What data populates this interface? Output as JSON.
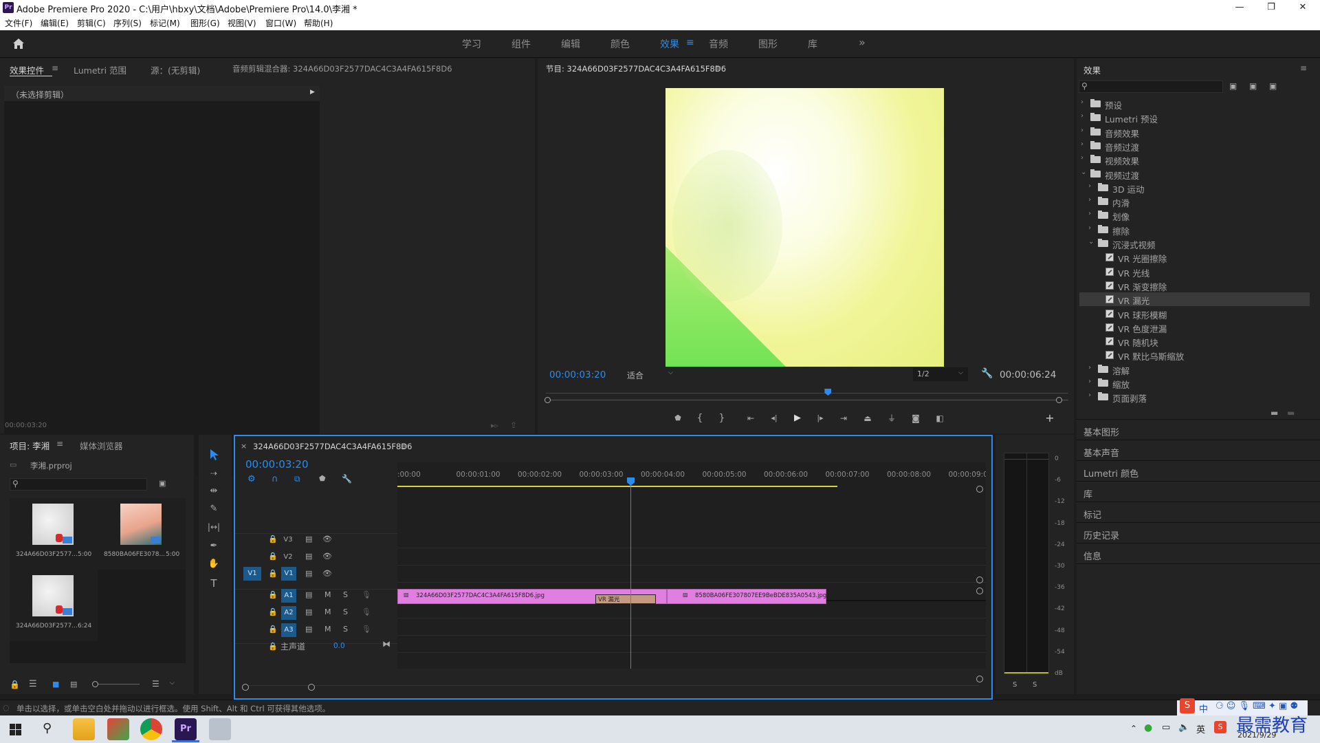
{
  "titlebar": {
    "title": "Adobe Premiere Pro 2020 - C:\\用户\\hbxy\\文档\\Adobe\\Premiere Pro\\14.0\\李湘 *",
    "logo": "Pr"
  },
  "menu": [
    "文件(F)",
    "编辑(E)",
    "剪辑(C)",
    "序列(S)",
    "标记(M)",
    "图形(G)",
    "视图(V)",
    "窗口(W)",
    "帮助(H)"
  ],
  "workspaces": {
    "items": [
      "学习",
      "组件",
      "编辑",
      "颜色",
      "效果",
      "音频",
      "图形",
      "库"
    ],
    "active": "效果",
    "more": "»"
  },
  "source_panel": {
    "tabs": [
      "效果控件",
      "Lumetri 范围",
      "源：(无剪辑)",
      "音频剪辑混合器: 324A66D03F2577DAC4C3A4FA615F8D6"
    ],
    "no_clip": "（未选择剪辑）",
    "timecode": "00:00:03:20"
  },
  "program_monitor": {
    "title": "节目: 324A66D03F2577DAC4C3A4FA615F8D6",
    "timecode": "00:00:03:20",
    "fit": "适合",
    "resolution": "1/2",
    "duration": "00:00:06:24",
    "playhead_fraction": 0.54
  },
  "effects_panel": {
    "title": "效果",
    "tree": [
      {
        "label": "预设",
        "level": 0,
        "kind": "folder-star",
        "open": false
      },
      {
        "label": "Lumetri 预设",
        "level": 0,
        "kind": "folder-star",
        "open": false
      },
      {
        "label": "音频效果",
        "level": 0,
        "kind": "folder",
        "open": false
      },
      {
        "label": "音频过渡",
        "level": 0,
        "kind": "folder",
        "open": false
      },
      {
        "label": "视频效果",
        "level": 0,
        "kind": "folder",
        "open": false
      },
      {
        "label": "视频过渡",
        "level": 0,
        "kind": "folder",
        "open": true
      },
      {
        "label": "3D 运动",
        "level": 1,
        "kind": "folder",
        "open": false
      },
      {
        "label": "内滑",
        "level": 1,
        "kind": "folder",
        "open": false
      },
      {
        "label": "划像",
        "level": 1,
        "kind": "folder",
        "open": false
      },
      {
        "label": "擦除",
        "level": 1,
        "kind": "folder",
        "open": false
      },
      {
        "label": "沉浸式视频",
        "level": 1,
        "kind": "folder",
        "open": true
      },
      {
        "label": "VR 光圈擦除",
        "level": 2,
        "kind": "fx"
      },
      {
        "label": "VR 光线",
        "level": 2,
        "kind": "fx"
      },
      {
        "label": "VR 渐变擦除",
        "level": 2,
        "kind": "fx"
      },
      {
        "label": "VR 漏光",
        "level": 2,
        "kind": "fx",
        "selected": true
      },
      {
        "label": "VR 球形模糊",
        "level": 2,
        "kind": "fx"
      },
      {
        "label": "VR 色度泄漏",
        "level": 2,
        "kind": "fx"
      },
      {
        "label": "VR 随机块",
        "level": 2,
        "kind": "fx"
      },
      {
        "label": "VR 默比乌斯缩放",
        "level": 2,
        "kind": "fx"
      },
      {
        "label": "溶解",
        "level": 1,
        "kind": "folder",
        "open": false
      },
      {
        "label": "缩放",
        "level": 1,
        "kind": "folder",
        "open": false
      },
      {
        "label": "页面剥落",
        "level": 1,
        "kind": "folder",
        "open": false
      }
    ],
    "side_panels": [
      "基本图形",
      "基本声音",
      "Lumetri 颜色",
      "库",
      "标记",
      "历史记录",
      "信息"
    ]
  },
  "project_panel": {
    "tabs": [
      "项目: 李湘",
      "媒体浏览器"
    ],
    "project_file": "李湘.prproj",
    "items": [
      {
        "name": "324A66D03F2577...",
        "duration": "5:00"
      },
      {
        "name": "8580BA06FE3078...",
        "duration": "5:00"
      },
      {
        "name": "324A66D03F2577...",
        "duration": "6:24"
      }
    ]
  },
  "timeline": {
    "tab": "324A66D03F2577DAC4C3A4FA615F8D6",
    "close": "×",
    "timecode": "00:00:03:20",
    "ruler": [
      ":00:00",
      "00:00:01:00",
      "00:00:02:00",
      "00:00:03:00",
      "00:00:04:00",
      "00:00:05:00",
      "00:00:06:00",
      "00:00:07:00",
      "00:00:08:00",
      "00:00:09:00"
    ],
    "video_tracks": [
      "V3",
      "V2",
      "V1"
    ],
    "audio_tracks": [
      "A1",
      "A2",
      "A3"
    ],
    "source_patch": "V1",
    "master_label": "主声道",
    "master_value": "0.0",
    "clip1": "324A66D03F2577DAC4C3A4FA615F8D6.jpg",
    "clip2": "8580BA06FE307807EE9BeBDE835A0543.jpg",
    "transition": "VR 漏光",
    "playhead_seconds": 3.8
  },
  "meter": {
    "scale": [
      "0",
      "-6",
      "-12",
      "-18",
      "-24",
      "-30",
      "-36",
      "-42",
      "-48",
      "-54",
      "dB"
    ],
    "solo": [
      "S",
      "S"
    ]
  },
  "status_bar": "单击以选择，或单击空白处并拖动以进行框选。使用 Shift、Alt 和 Ctrl 可获得其他选项。",
  "taskbar": {
    "date": "2021/9/29",
    "watermark": "最需教育",
    "ime": "中"
  },
  "colors": {
    "accent": "#2d8ceb",
    "clip": "#e07fe0",
    "timeline_border": "#2d8ceb",
    "panel": "#232323"
  }
}
